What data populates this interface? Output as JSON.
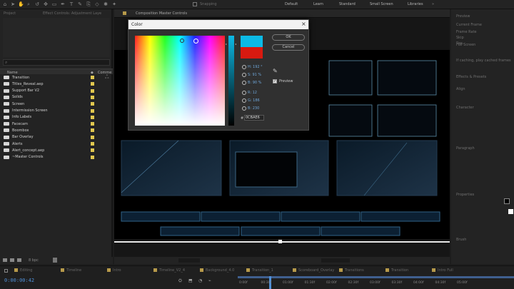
{
  "toolbar": {
    "snapping_label": "Snapping",
    "workspaces": [
      "Default",
      "Learn",
      "Standard",
      "Small Screen",
      "Libraries"
    ]
  },
  "project": {
    "tab": "Project",
    "tab2": "Effect Controls: Adjustment Laye",
    "column_name": "Name",
    "column_comment": "Comme",
    "items": [
      "Transition",
      "Titles_Reveal.aep",
      "Support Bar V2",
      "Solids",
      "Screen",
      "Intermission Screen",
      "Info Labels",
      "Facecam",
      "Boombox",
      "Bar Overlay",
      "Alerts",
      "Alert_concept.aep",
      "~Master Controls"
    ],
    "bit_depth": "8 bpc"
  },
  "comp": {
    "tab": "Composition Master Controls"
  },
  "color_dialog": {
    "title": "Color",
    "ok": "OK",
    "cancel": "Cancel",
    "h": "H: 192 °",
    "s": "S: 91 %",
    "b": "B: 90 %",
    "r": "R: 12",
    "g": "G: 186",
    "bl": "B: 230",
    "hex": "0CBAE6",
    "preview": "Preview",
    "new_color": "#0cbae6",
    "old_color": "#d81a10"
  },
  "right_panel": {
    "labels": [
      "Preview",
      "Current Frame",
      "Frame Rate",
      "Skip",
      "Res.",
      "Full Screen",
      "If caching, play cached frames",
      "Effects & Presets",
      "Align",
      "Character",
      "Paragraph",
      "Properties",
      "Brush"
    ]
  },
  "timeline": {
    "timecode": "0:00:00:42",
    "tabs": [
      "Editing",
      "Timeline",
      "Intro",
      "Timeline_V2_4",
      "Background_4.0",
      "Transition_1",
      "Scoreboard_Overlay",
      "Transitions",
      "Transition",
      "Intro Full"
    ],
    "ticks": [
      "0:00f",
      "00:30f",
      "01:00f",
      "01:30f",
      "02:00f",
      "02:30f",
      "03:00f",
      "03:30f",
      "04:00f",
      "04:30f",
      "05:00f"
    ]
  }
}
